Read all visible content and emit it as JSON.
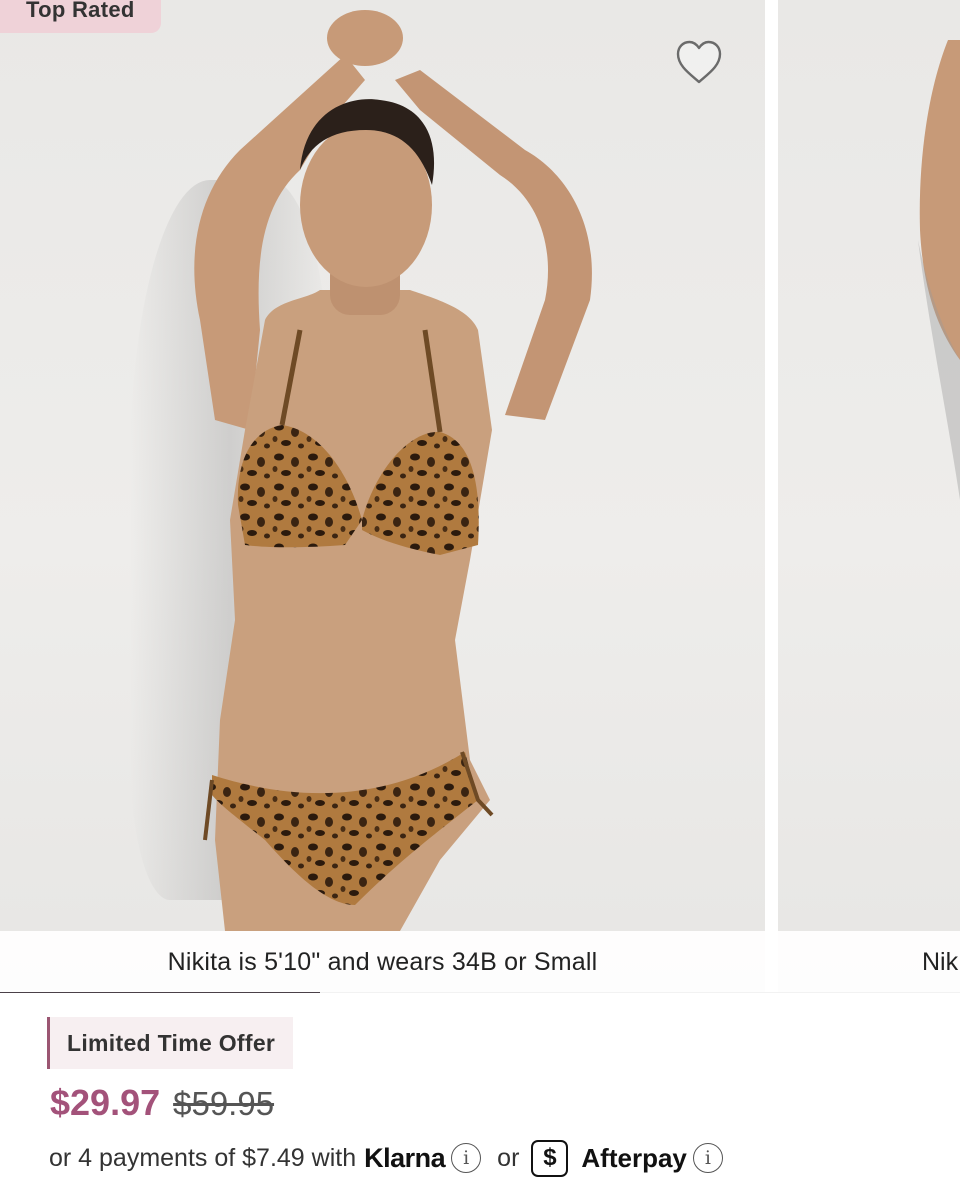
{
  "product_card": {
    "badge": "Top Rated",
    "caption": "Nikita  is 5'10\" and wears 34B or Small",
    "next_caption": "Nik",
    "carousel_progress": 0.333,
    "offer_label": "Limited Time Offer",
    "price_sale": "$29.97",
    "price_original": "$59.95",
    "installments": {
      "prefix": "or 4 payments of $7.49 with",
      "klarna": "Klarna",
      "or": "or",
      "afterpay_icon": "$",
      "afterpay": "Afterpay",
      "info_icon": "i"
    }
  },
  "colors": {
    "badge_bg": "#efd2d8",
    "sale_price": "#a3527a",
    "offer_accent": "#9b5672",
    "progress": "#4a4048"
  },
  "icons": [
    "heart-icon",
    "info-icon",
    "afterpay-icon"
  ]
}
